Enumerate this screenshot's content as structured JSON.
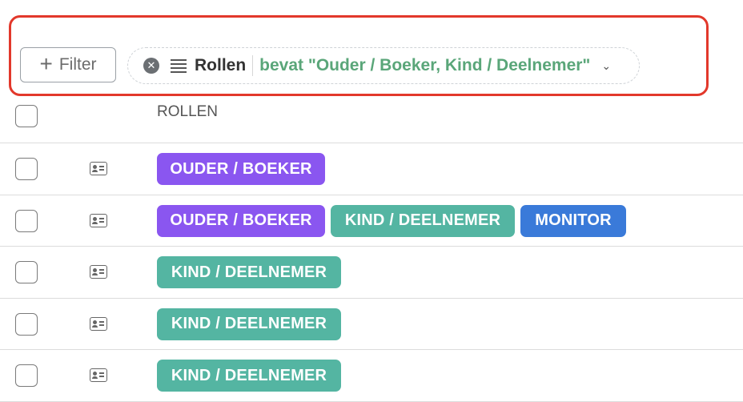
{
  "filter_bar": {
    "add_filter_label": "Filter",
    "chip": {
      "field": "Rollen",
      "condition": "bevat \"Ouder / Boeker, Kind / Deelnemer\""
    }
  },
  "table": {
    "header": "ROLLEN",
    "rows": [
      {
        "tags": [
          {
            "label": "OUDER / BOEKER",
            "color": "#8a56f0"
          }
        ]
      },
      {
        "tags": [
          {
            "label": "OUDER / BOEKER",
            "color": "#8a56f0"
          },
          {
            "label": "KIND / DEELNEMER",
            "color": "#54b5a2"
          },
          {
            "label": "MONITOR",
            "color": "#3a7ad9"
          }
        ]
      },
      {
        "tags": [
          {
            "label": "KIND / DEELNEMER",
            "color": "#54b5a2"
          }
        ]
      },
      {
        "tags": [
          {
            "label": "KIND / DEELNEMER",
            "color": "#54b5a2"
          }
        ]
      },
      {
        "tags": [
          {
            "label": "KIND / DEELNEMER",
            "color": "#54b5a2"
          }
        ]
      }
    ]
  },
  "icons": {
    "add": "plus-icon",
    "clear": "close-circle-icon",
    "field_type": "list-icon",
    "dropdown": "chevron-down-icon",
    "row": "contact-card-icon"
  },
  "colors": {
    "highlight_border": "#e2382b",
    "condition_text": "#5aa679"
  }
}
